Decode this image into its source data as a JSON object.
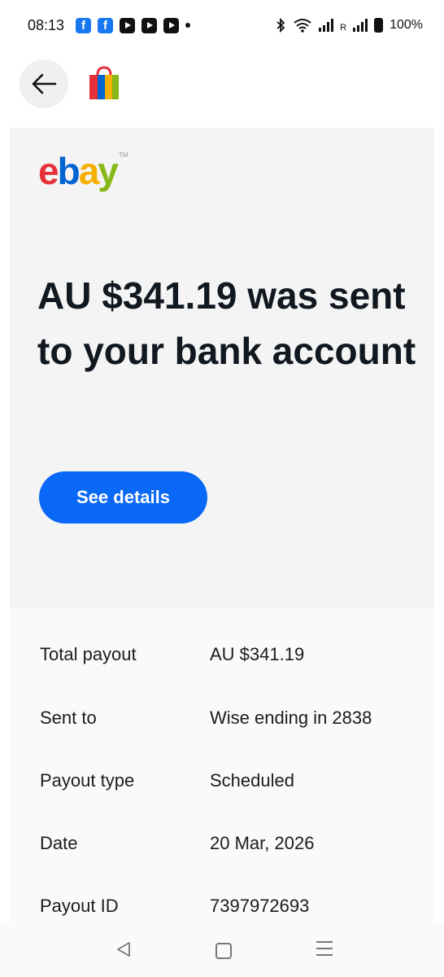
{
  "status_bar": {
    "time": "08:13",
    "network_label": "R",
    "battery": "100%",
    "icons": [
      "facebook-icon",
      "facebook-icon",
      "youtube-icon",
      "youtube-icon",
      "youtube-icon",
      "dot-icon",
      "bluetooth-icon",
      "wifi-icon",
      "signal-icon",
      "signal-icon",
      "battery-icon"
    ]
  },
  "header": {
    "back_icon": "arrow-left-icon",
    "app_icon": "shopping-bag-icon"
  },
  "email": {
    "logo_text": [
      "e",
      "b",
      "a",
      "y"
    ],
    "logo_colors": [
      "#e53238",
      "#0064d2",
      "#f5af02",
      "#86b817"
    ],
    "logo_tm": "TM",
    "headline": "AU $341.19 was sent to your bank account",
    "cta_label": "See details",
    "cta_color": "#0968f6"
  },
  "details": [
    {
      "label": "Total payout",
      "value": "AU $341.19"
    },
    {
      "label": "Sent to",
      "value": "Wise ending in 2838"
    },
    {
      "label": "Payout type",
      "value": "Scheduled"
    },
    {
      "label": "Date",
      "value": "20 Mar, 2026"
    },
    {
      "label": "Payout ID",
      "value": "7397972693"
    }
  ],
  "nav": {
    "back": "triangle-back-icon",
    "home": "square-home-icon",
    "recents": "menu-lines-icon"
  }
}
